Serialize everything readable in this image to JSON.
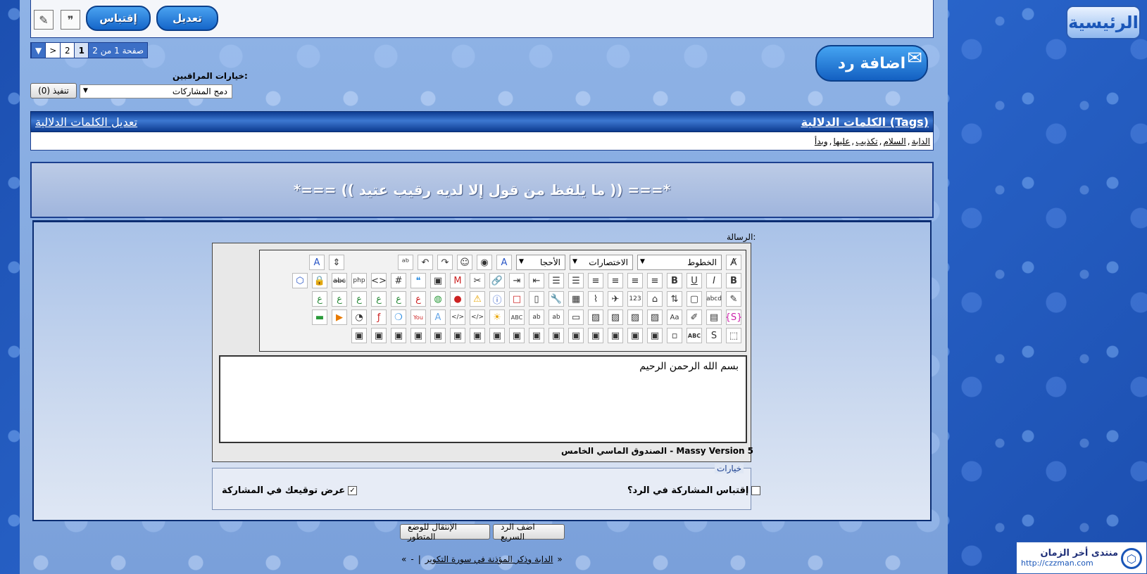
{
  "topbar": {
    "edit_label": "تعديل",
    "quote_label": "إقتباس"
  },
  "pagination": {
    "label": "صفحة 1 من 2",
    "pages": [
      "1",
      "2"
    ],
    "next": ">",
    "current": "1"
  },
  "moderation": {
    "label": "خيارات المراقبين:",
    "selected": "دمج المشاركات",
    "go_label": "(0) تنفيذ"
  },
  "reply_button": "اضافة رد",
  "home_button": "الرئيسية",
  "tags": {
    "heading": "الكلمات الدلالية (Tags)",
    "edit_link": "تعديل الكلمات الدلالية",
    "items": [
      "الدابة",
      "السلام",
      "تكذيب",
      "عليها",
      "وبدأ"
    ]
  },
  "post_title": "*=== (( ما يلفظ من قول إلا لديه رقيب عتيد )) ===*",
  "editor": {
    "message_label": "الرسالة:",
    "font_select": "الخطوط",
    "shortcut_select": "الاختصارات",
    "size_select": "الأحجا",
    "body_text": "بسم الله الرحمن الرحيم",
    "footer": "الصندوق الماسي الخامس - Massy Version 5"
  },
  "options": {
    "legend": "خيارات",
    "quote_post": "إقتباس المشاركة في الرد؟",
    "show_signature": "عرض توقيعك في المشاركة",
    "quote_checked": false,
    "signature_checked": true
  },
  "buttons": {
    "quick_reply": "اضف الرد السريع",
    "advanced": "الإنتقال للوضع المتطور"
  },
  "bottom_nav": {
    "prev": "«",
    "link": "الدابة وذكر المؤذنة في سورة التكوير",
    "sep": "|",
    "dash": "-",
    "next": "»"
  },
  "forum_logo": {
    "name": "منتدى أخر الزمان",
    "url": "http://czzman.com"
  }
}
